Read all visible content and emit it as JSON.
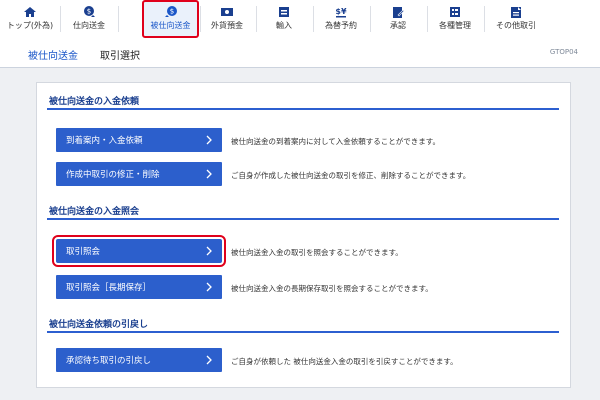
{
  "nav": {
    "items": [
      {
        "label": "トップ(外為)",
        "icon": "home-icon"
      },
      {
        "label": "仕向送金",
        "icon": "outgoing-remittance-icon"
      },
      {
        "label": "被仕向送金",
        "icon": "incoming-remittance-icon",
        "active": true
      },
      {
        "label": "外貨預金",
        "icon": "foreign-deposit-icon"
      },
      {
        "label": "輸入",
        "icon": "import-icon"
      },
      {
        "label": "為替予約",
        "icon": "exchange-contract-icon"
      },
      {
        "label": "承認",
        "icon": "approval-icon"
      },
      {
        "label": "各種管理",
        "icon": "management-icon"
      },
      {
        "label": "その他取引",
        "icon": "other-transaction-icon"
      }
    ]
  },
  "header": {
    "breadcrumb": "被仕向送金",
    "title": "取引選択",
    "screen_code": "GTOP04"
  },
  "sections": [
    {
      "title": "被仕向送金の入金依頼",
      "rows": [
        {
          "button": "到着案内・入金依頼",
          "desc": "被仕向送金の到着案内に対して入金依頼することができます。"
        },
        {
          "button": "作成中取引の修正・削除",
          "desc": "ご自身が作成した被仕向送金の取引を修正、削除することができます。"
        }
      ]
    },
    {
      "title": "被仕向送金の入金照会",
      "rows": [
        {
          "button": "取引照会",
          "desc": "被仕向送金入金の取引を照会することができます。",
          "highlighted": true
        },
        {
          "button": "取引照会［長期保存］",
          "desc": "被仕向送金入金の長期保存取引を照会することができます。"
        }
      ]
    },
    {
      "title": "被仕向送金依頼の引戻し",
      "rows": [
        {
          "button": "承認待ち取引の引戻し",
          "desc": "ご自身が依頼した 被仕向送金入金の取引を引戻すことができます。"
        }
      ]
    }
  ],
  "colors": {
    "accent": "#2c5fcc",
    "highlight": "#e0001b",
    "section_title": "#1a3f8f"
  }
}
